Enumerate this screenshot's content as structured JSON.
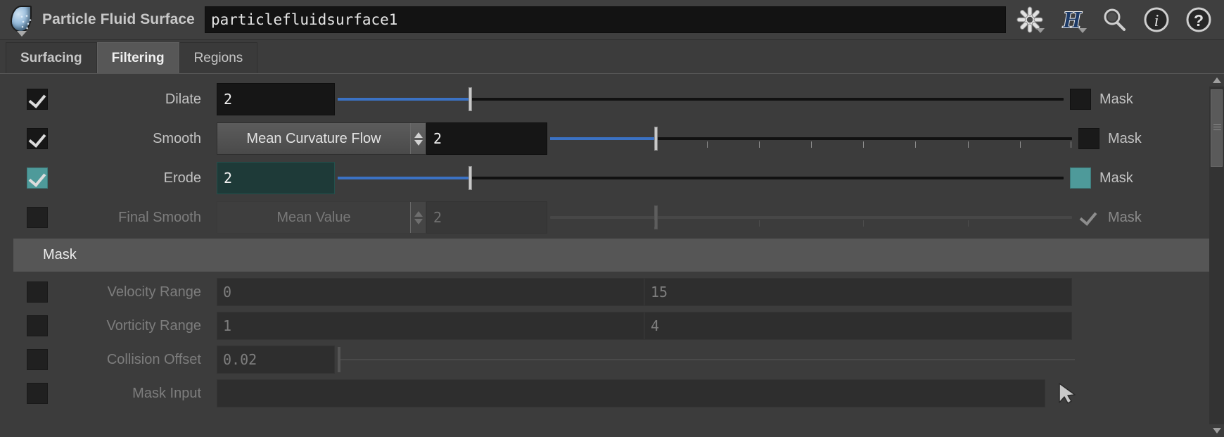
{
  "titlebar": {
    "node_icon": "particle-fluid-surface-node-icon",
    "title": "Particle Fluid Surface",
    "name_value": "particlefluidsurface1",
    "icons": [
      {
        "name": "gear-icon",
        "glyph": "gear"
      },
      {
        "name": "houdini-h-icon",
        "glyph": "H"
      },
      {
        "name": "search-icon",
        "glyph": "magnifier"
      },
      {
        "name": "info-icon",
        "glyph": "i"
      },
      {
        "name": "help-icon",
        "glyph": "?"
      }
    ]
  },
  "tabs": [
    {
      "label": "Surfacing",
      "active": false,
      "bold": true
    },
    {
      "label": "Filtering",
      "active": true,
      "bold": true
    },
    {
      "label": "Regions",
      "active": false,
      "bold": false
    }
  ],
  "filter_rows": [
    {
      "enabled_label": "Dilate",
      "checked": true,
      "value": "2",
      "has_menu": false,
      "menu_value": "",
      "slider_percent": 18,
      "mask_label": "Mask",
      "mask_checked": false,
      "disabled": false,
      "highlight": false
    },
    {
      "enabled_label": "Smooth",
      "checked": true,
      "value": "2",
      "has_menu": true,
      "menu_value": "Mean Curvature Flow",
      "slider_percent": 20,
      "mask_label": "Mask",
      "mask_checked": false,
      "disabled": false,
      "highlight": false
    },
    {
      "enabled_label": "Erode",
      "checked": true,
      "value": "2",
      "has_menu": false,
      "menu_value": "",
      "slider_percent": 18,
      "mask_label": "Mask",
      "mask_checked": true,
      "disabled": false,
      "highlight": true
    },
    {
      "enabled_label": "Final Smooth",
      "checked": false,
      "value": "2",
      "has_menu": true,
      "menu_value": "Mean Value",
      "slider_percent": 20,
      "mask_label": "Mask",
      "mask_checked": false,
      "disabled": true,
      "highlight": false
    }
  ],
  "mask_section": {
    "title": "Mask"
  },
  "mask_rows": [
    {
      "label": "Velocity Range",
      "checked": false,
      "value1": "0",
      "value2": "15",
      "type": "range"
    },
    {
      "label": "Vorticity Range",
      "checked": false,
      "value1": "1",
      "value2": "4",
      "type": "range"
    },
    {
      "label": "Collision Offset",
      "checked": false,
      "value1": "0.02",
      "value2": "",
      "type": "slider"
    },
    {
      "label": "Mask Input",
      "checked": false,
      "value1": "",
      "value2": "",
      "type": "input"
    }
  ],
  "colors": {
    "panel_bg": "#3c3c3c",
    "field_bg": "#161616",
    "accent_slider": "#3b72c4",
    "highlight_teal": "#4e9a9a",
    "highlight_field": "#1e3a38",
    "section_header": "#565656",
    "text": "#c2c2c2",
    "text_dim": "#7d7d7d"
  }
}
